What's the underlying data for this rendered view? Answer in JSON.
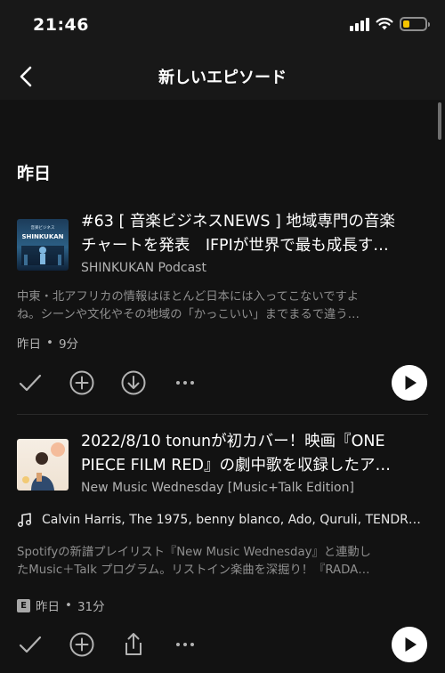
{
  "status": {
    "time": "21:46"
  },
  "nav": {
    "title": "新しいエピソード",
    "back_icon": "chevron-left-icon"
  },
  "section": {
    "heading": "昨日"
  },
  "episodes": [
    {
      "title_line1": "#63 [ 音楽ビジネスNEWS ] 地域専門の音楽",
      "title_line2": "チャートを発表　IFPIが世界で最も成長す…",
      "show": "SHINKUKAN Podcast",
      "desc_line1": "中東・北アフリカの情報はほとんど日本には入ってこないですよ",
      "desc_line2": "ね。シーンや文化やその地域の「かっこいい」までまるで違う…",
      "date": "昨日",
      "sep": "•",
      "duration": "9分",
      "art_text": "SHINKUKAN",
      "art_small": "音楽ビジネス"
    },
    {
      "title_line1": "2022/8/10 tonunが初カバー！映画『ONE",
      "title_line2": "PIECE FILM RED』の劇中歌を収録したア…",
      "show": "New Music Wednesday [Music+Talk Edition]",
      "artists": "Calvin Harris, The 1975, benny blanco, Ado, Quruli, TENDR…",
      "desc_line1": "Spotifyの新譜プレイリスト『New Music Wednesday』と連動し",
      "desc_line2": "たMusic＋Talk プログラム。リストイン楽曲を深掘り！『RADA…",
      "explicit": "E",
      "date": "昨日",
      "sep": "•",
      "duration": "31分"
    }
  ],
  "colors": {
    "background": "#121212",
    "header": "#181818",
    "secondary_text": "#b3b3b3",
    "battery": "#f5c400"
  }
}
